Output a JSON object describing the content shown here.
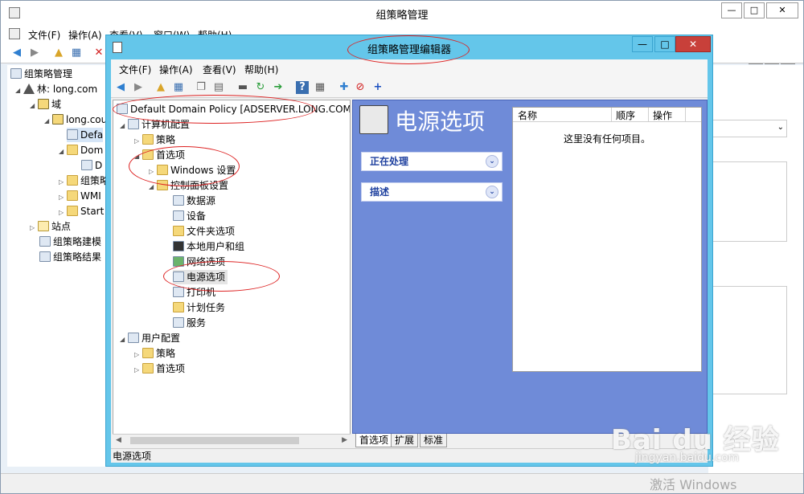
{
  "bg_window": {
    "title": "组策略管理",
    "controls": {
      "minimize": "—",
      "maximize": "□",
      "close": "✕"
    },
    "mdi_controls": {
      "minimize": "_",
      "restore": "❐",
      "close": "✕"
    },
    "menu": [
      "文件(F)",
      "操作(A)",
      "查看(V)",
      "窗口(W)",
      "帮助(H)"
    ],
    "tree": [
      {
        "label": "组策略管理",
        "icon": "gpmc-icon"
      },
      {
        "label": "林: long.com",
        "icon": "forest-icon"
      },
      {
        "label": "域",
        "icon": "folder-icon"
      },
      {
        "label": "long.cou",
        "icon": "domain-icon"
      },
      {
        "label": "Defa",
        "icon": "gpo-icon"
      },
      {
        "label": "Dom",
        "icon": "folder-icon"
      },
      {
        "label": "D",
        "icon": "gpo-icon"
      },
      {
        "label": "组策略",
        "icon": "folder-icon"
      },
      {
        "label": "WMI",
        "icon": "folder-icon"
      },
      {
        "label": "Start",
        "icon": "folder-icon"
      },
      {
        "label": "站点",
        "icon": "site-icon"
      },
      {
        "label": "组策略建模",
        "icon": "modeling-icon"
      },
      {
        "label": "组策略结果",
        "icon": "results-icon"
      }
    ]
  },
  "fg_window": {
    "title": "组策略管理编辑器",
    "controls": {
      "minimize": "—",
      "maximize": "□",
      "close": "✕"
    },
    "menu": [
      "文件(F)",
      "操作(A)",
      "查看(V)",
      "帮助(H)"
    ],
    "tree": {
      "root": "Default Domain Policy [ADSERVER.LONG.COM] 策",
      "computer_config": "计算机配置",
      "policies": "策略",
      "preferences": "首选项",
      "windows_settings": "Windows 设置",
      "control_panel": "控制面板设置",
      "cp_items": [
        "数据源",
        "设备",
        "文件夹选项",
        "本地用户和组",
        "网络选项",
        "电源选项",
        "打印机",
        "计划任务",
        "服务"
      ],
      "user_config": "用户配置",
      "user_policies": "策略",
      "user_preferences": "首选项"
    },
    "detail": {
      "heading": "电源选项",
      "task_processing": "正在处理",
      "task_description": "描述",
      "columns": [
        "名称",
        "顺序",
        "操作"
      ],
      "empty_text": "这里没有任何项目。"
    },
    "tabs": [
      "首选项",
      "扩展",
      "标准"
    ],
    "status": "电源选项"
  },
  "watermark": {
    "brand": "Bai du 经验",
    "url": "jingyan.baidu.com",
    "activate": "激活 Windows"
  }
}
